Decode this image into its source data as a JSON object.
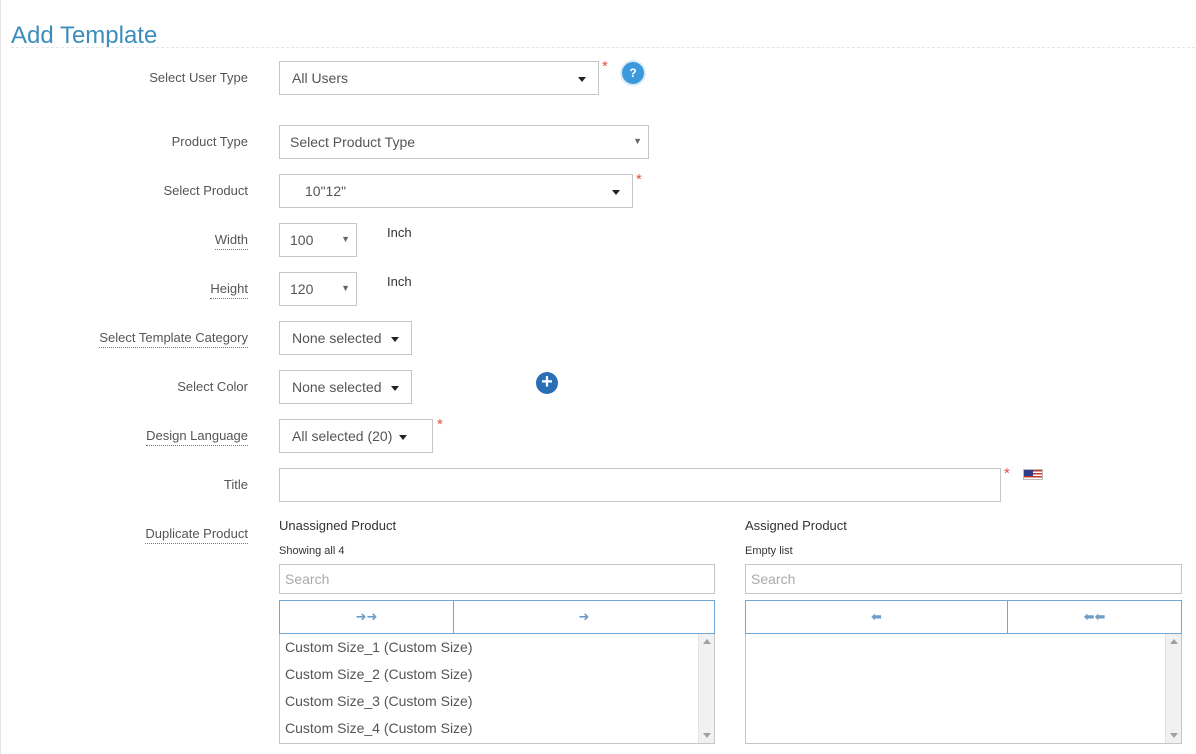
{
  "page": {
    "title": "Add Template"
  },
  "form": {
    "user_type": {
      "label": "Select User Type",
      "value": "All Users",
      "required": "*"
    },
    "product_type": {
      "label": "Product Type",
      "value": "Select Product Type"
    },
    "product": {
      "label": "Select Product",
      "value": "10\"12\"",
      "required": "*"
    },
    "width": {
      "label": "Width",
      "value": "100",
      "unit": "Inch"
    },
    "height": {
      "label": "Height",
      "value": "120",
      "unit": "Inch"
    },
    "template_category": {
      "label": "Select Template Category",
      "value": "None selected"
    },
    "color": {
      "label": "Select Color",
      "value": "None selected"
    },
    "design_language": {
      "label": "Design Language",
      "value": "All selected (20)",
      "required": "*"
    },
    "title": {
      "label": "Title",
      "value": "",
      "required": "*"
    },
    "duplicate_product": {
      "label": "Duplicate Product"
    }
  },
  "dual_list": {
    "unassigned": {
      "heading": "Unassigned Product",
      "info": "Showing all 4",
      "search_placeholder": "Search",
      "move_all": "➜➜",
      "move_selected": "➜",
      "items": [
        "Custom Size_1 (Custom Size)",
        "Custom Size_2 (Custom Size)",
        "Custom Size_3 (Custom Size)",
        "Custom Size_4 (Custom Size)"
      ]
    },
    "assigned": {
      "heading": "Assigned Product",
      "info": "Empty list",
      "search_placeholder": "Search",
      "remove_selected": "⬅",
      "remove_all": "⬅⬅",
      "items": []
    }
  },
  "icons": {
    "help": "question-circle-icon",
    "add": "plus-circle-icon",
    "flag": "us-flag-icon"
  },
  "colors": {
    "accent": "#3c8dbc",
    "required": "#e0553d",
    "button_border": "#6fa8d6"
  }
}
